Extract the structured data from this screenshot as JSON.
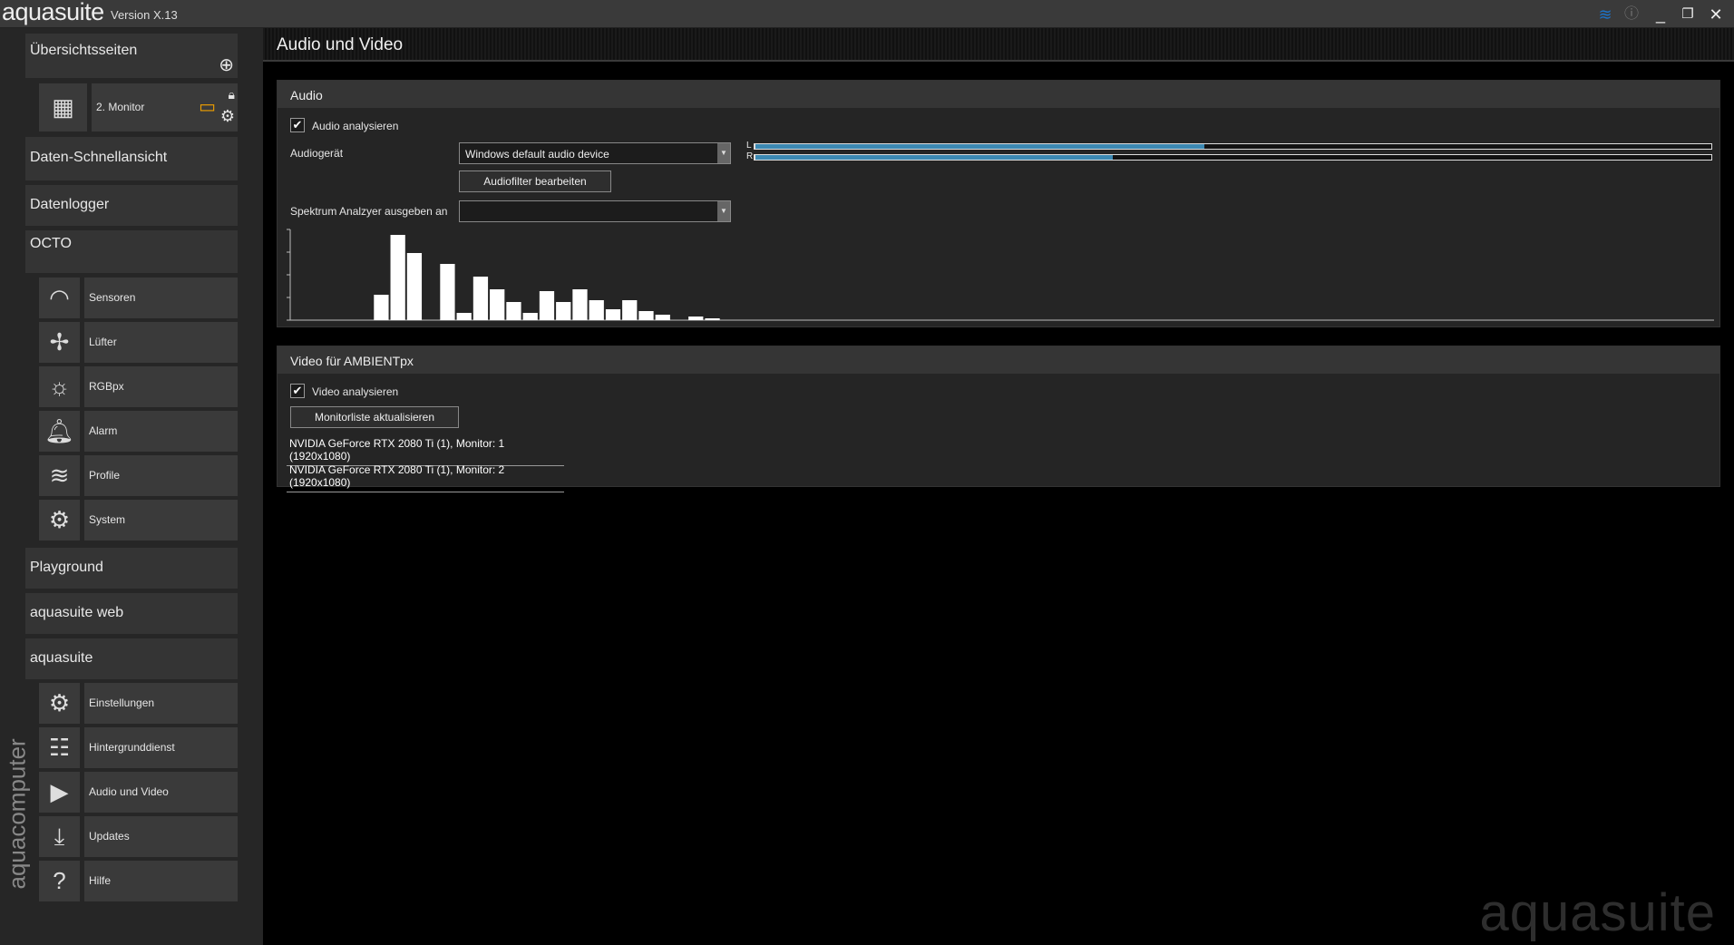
{
  "app": {
    "name": "aquasuite",
    "version": "Version X.13",
    "watermark": "aquasuite",
    "vendor": "aquacomputer"
  },
  "titlebar": {
    "icons": [
      "layers-icon",
      "info-icon",
      "minimize-icon",
      "restore-icon",
      "close-icon"
    ]
  },
  "sidebar": {
    "overview": "Übersichtsseiten",
    "monitor_page": "2. Monitor",
    "quick_view": "Daten-Schnellansicht",
    "datalogger": "Datenlogger",
    "device": "OCTO",
    "device_items": [
      {
        "label": "Sensoren",
        "icon": "gauge-icon"
      },
      {
        "label": "Lüfter",
        "icon": "fan-icon"
      },
      {
        "label": "RGBpx",
        "icon": "bulb-icon"
      },
      {
        "label": "Alarm",
        "icon": "alarm-icon"
      },
      {
        "label": "Profile",
        "icon": "layers-icon"
      },
      {
        "label": "System",
        "icon": "gear-icon"
      }
    ],
    "playground": "Playground",
    "web": "aquasuite web",
    "aquasuite": "aquasuite",
    "aquasuite_items": [
      {
        "label": "Einstellungen",
        "icon": "gear-icon"
      },
      {
        "label": "Hintergrunddienst",
        "icon": "service-icon"
      },
      {
        "label": "Audio und Video",
        "icon": "film-icon"
      },
      {
        "label": "Updates",
        "icon": "download-icon"
      },
      {
        "label": "Hilfe",
        "icon": "help-icon"
      }
    ]
  },
  "main": {
    "title": "Audio und Video",
    "audio": {
      "header": "Audio",
      "analyze_label": "Audio analysieren",
      "analyze_checked": true,
      "device_label": "Audiogerät",
      "device_value": "Windows default audio device",
      "filter_button": "Audiofilter bearbeiten",
      "spectrum_label": "Spektrum Analzyer ausgeben an",
      "spectrum_value": "",
      "level_left_label": "L",
      "level_right_label": "R",
      "level_left": 0.47,
      "level_right": 0.374,
      "accent": "#3c89b3"
    },
    "video": {
      "header": "Video für AMBIENTpx",
      "analyze_label": "Video analysieren",
      "analyze_checked": true,
      "refresh_button": "Monitorliste aktualisieren",
      "monitors": [
        "NVIDIA GeForce RTX 2080 Ti (1), Monitor: 1 (1920x1080)",
        "NVIDIA GeForce RTX 2080 Ti (1), Monitor: 2 (1920x1080)"
      ]
    }
  },
  "chart_data": {
    "type": "bar",
    "title": "",
    "xlabel": "",
    "ylabel": "",
    "ylim": [
      0,
      100
    ],
    "bins": 86,
    "values": [
      0,
      0,
      0,
      0,
      0,
      14,
      47,
      37,
      0,
      31,
      4,
      24,
      17,
      10,
      4,
      16,
      10,
      17,
      11,
      6,
      11,
      5,
      3,
      0,
      2,
      1
    ]
  }
}
